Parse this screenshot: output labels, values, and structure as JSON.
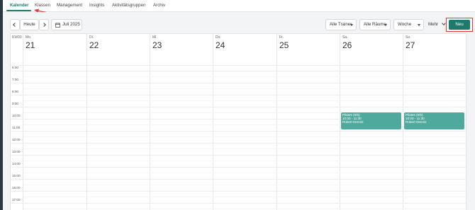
{
  "nav": {
    "tabs": [
      {
        "label": "Kalender",
        "active": true
      },
      {
        "label": "Klassen",
        "active": false
      },
      {
        "label": "Management",
        "active": false
      },
      {
        "label": "Insights",
        "active": false
      },
      {
        "label": "Aktivitätsgruppen",
        "active": false
      },
      {
        "label": "Archiv",
        "active": false
      }
    ]
  },
  "toolbar": {
    "today_label": "Heute",
    "date_label": "Juli 2025",
    "trainer_filter": "Alle Trainer",
    "room_filter": "Alle Räume",
    "view_select": "Woche",
    "more_label": "Mehr",
    "new_label": "Neu"
  },
  "calendar": {
    "week_label": "KW30",
    "days": [
      {
        "name": "Mo.",
        "num": "21"
      },
      {
        "name": "Di.",
        "num": "22"
      },
      {
        "name": "Mi.",
        "num": "23"
      },
      {
        "name": "Do.",
        "num": "24"
      },
      {
        "name": "Fr.",
        "num": "25"
      },
      {
        "name": "Sa.",
        "num": "26"
      },
      {
        "name": "So.",
        "num": "27"
      }
    ],
    "hours": [
      "6:00",
      "7:00",
      "8:00",
      "9:00",
      "10:00",
      "11:00",
      "12:00",
      "13:00",
      "14:00",
      "15:00",
      "16:00",
      "17:00"
    ],
    "events": [
      {
        "day": 5,
        "title": "Pilates (0/5)",
        "time": "10:00 - 11:30",
        "trainer": "Robert Dennis"
      },
      {
        "day": 6,
        "title": "Pilates (0/5)",
        "time": "10:00 - 11:30",
        "trainer": "Robert Dennis"
      }
    ]
  },
  "colors": {
    "accent": "#1f7a6e",
    "event": "#4fa99d",
    "highlight": "#e03a3a"
  }
}
